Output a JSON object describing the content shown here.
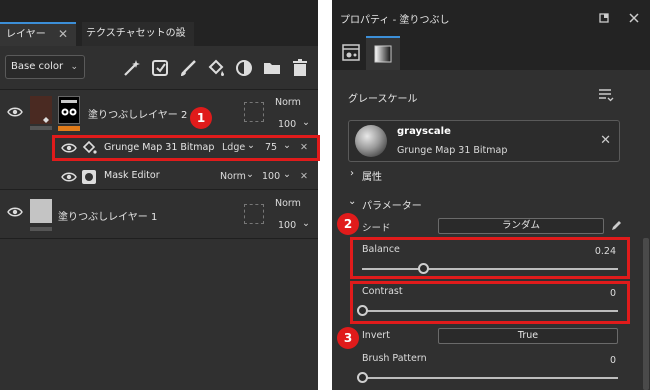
{
  "layers_panel": {
    "tabs": [
      {
        "label": "レイヤー",
        "close": "✕"
      },
      {
        "label": "テクスチャセットの設定"
      }
    ],
    "channel_select": {
      "value": "Base color",
      "chevron": "⌄"
    },
    "tools": [
      "magic-wand-icon",
      "add-effect-icon",
      "brush-icon",
      "fill-icon",
      "mask-icon",
      "folder-icon",
      "trash-icon"
    ],
    "layers": [
      {
        "name": "塗りつぶしレイヤー 2",
        "blend": "Norm",
        "opacity": "100",
        "effects": [
          {
            "name": "Grunge Map 31 Bitmap",
            "blend": "Ldge",
            "opacity": "75",
            "close": "✕"
          },
          {
            "name": "Mask Editor",
            "blend": "Norm",
            "opacity": "100",
            "close": "✕"
          }
        ]
      },
      {
        "name": "塗りつぶしレイヤー 1",
        "blend": "Norm",
        "opacity": "100"
      }
    ],
    "arrow": "⌄"
  },
  "properties_panel": {
    "title": "プロパティ - 塗りつぶし",
    "section_title": "グレースケール",
    "resource": {
      "name": "grayscale",
      "subtitle": "Grunge Map 31 Bitmap",
      "close": "✕"
    },
    "attributes_label": "属性",
    "parameters_label": "パラメーター",
    "seed": {
      "label": "シード",
      "value": "ランダム"
    },
    "balance": {
      "label": "Balance",
      "value": "0.24",
      "fraction": 0.24
    },
    "contrast": {
      "label": "Contrast",
      "value": "0",
      "fraction": 0
    },
    "invert": {
      "label": "Invert",
      "value": "True"
    },
    "brush_pattern": {
      "label": "Brush Pattern",
      "value": "0",
      "fraction": 0
    }
  },
  "annotations": [
    "1",
    "2",
    "3"
  ],
  "colors": {
    "highlight": "#e01b1b",
    "accent_tab": "#3c8fd8",
    "orange_bar": "#e07b1a"
  }
}
